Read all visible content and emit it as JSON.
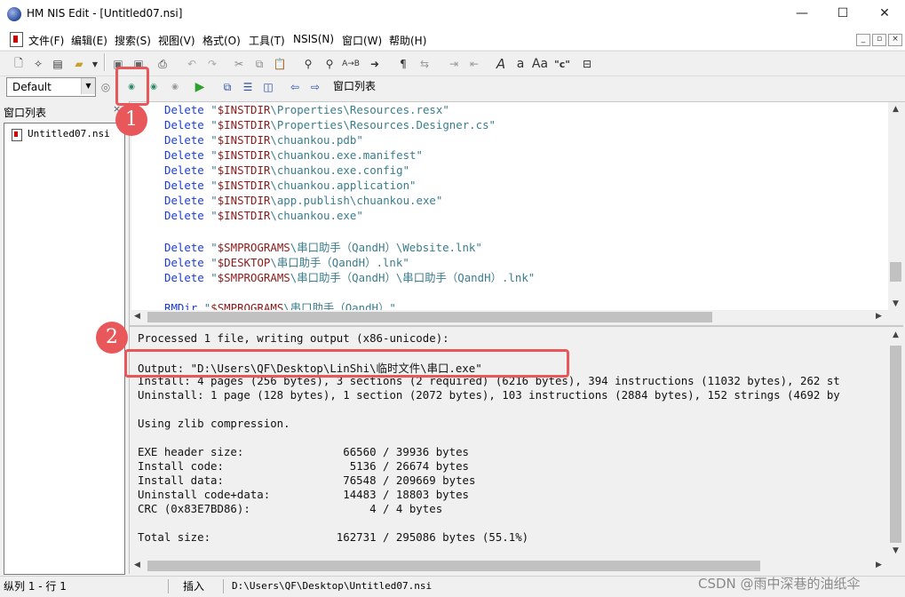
{
  "window": {
    "title": "HM NIS Edit - [Untitled07.nsi]",
    "min": "—",
    "max": "☐",
    "close": "✕"
  },
  "menu": [
    "文件(F)",
    "编辑(E)",
    "搜索(S)",
    "视图(V)",
    "格式(O)",
    "工具(T)",
    "NSIS(N)",
    "窗口(W)",
    "帮助(H)"
  ],
  "toolbar": {
    "preset": "Default",
    "window_list": "窗口列表"
  },
  "left_panel": {
    "title": "窗口列表",
    "close": "×",
    "file": "Untitled07.nsi"
  },
  "editor": {
    "lines": [
      {
        "kw": "Delete",
        "var": "$INSTDIR",
        "rest": "\\Properties\\Resources.resx\""
      },
      {
        "kw": "Delete",
        "var": "$INSTDIR",
        "rest": "\\Properties\\Resources.Designer.cs\""
      },
      {
        "kw": "Delete",
        "var": "$INSTDIR",
        "rest": "\\chuankou.pdb\""
      },
      {
        "kw": "Delete",
        "var": "$INSTDIR",
        "rest": "\\chuankou.exe.manifest\""
      },
      {
        "kw": "Delete",
        "var": "$INSTDIR",
        "rest": "\\chuankou.exe.config\""
      },
      {
        "kw": "Delete",
        "var": "$INSTDIR",
        "rest": "\\chuankou.application\""
      },
      {
        "kw": "Delete",
        "var": "$INSTDIR",
        "rest": "\\app.publish\\chuankou.exe\""
      },
      {
        "kw": "Delete",
        "var": "$INSTDIR",
        "rest": "\\chuankou.exe\""
      },
      {
        "kw": "Delete",
        "var": "$SMPROGRAMS",
        "rest": "\\串口助手（QandH）\\Website.lnk\""
      },
      {
        "kw": "Delete",
        "var": "$DESKTOP",
        "rest": "\\串口助手（QandH）.lnk\""
      },
      {
        "kw": "Delete",
        "var": "$SMPROGRAMS",
        "rest": "\\串口助手（QandH）\\串口助手（QandH）.lnk\""
      },
      {
        "kw": "RMDir",
        "var": "$SMPROGRAMS",
        "rest": "\\串口助手（QandH）\""
      }
    ]
  },
  "output": {
    "lines": [
      "Processed 1 file, writing output (x86-unicode):",
      "",
      "Output: \"D:\\Users\\QF\\Desktop\\LinShi\\临时文件\\串口.exe\"",
      "Install: 4 pages (256 bytes), 3 sections (2 required) (6216 bytes), 394 instructions (11032 bytes), 262 st",
      "Uninstall: 1 page (128 bytes), 1 section (2072 bytes), 103 instructions (2884 bytes), 152 strings (4692 by",
      "",
      "Using zlib compression.",
      "",
      "EXE header size:               66560 / 39936 bytes",
      "Install code:                   5136 / 26674 bytes",
      "Install data:                  76548 / 209669 bytes",
      "Uninstall code+data:           14483 / 18803 bytes",
      "CRC (0x83E7BD86):                  4 / 4 bytes",
      "",
      "Total size:                   162731 / 295086 bytes (55.1%)"
    ]
  },
  "status": {
    "position": "纵列 1 - 行 1",
    "mode": "插入",
    "path": "D:\\Users\\QF\\Desktop\\Untitled07.nsi"
  },
  "annotations": {
    "badge1": "1",
    "badge2": "2"
  },
  "watermark": "CSDN @雨中深巷的油纸伞",
  "colors": {
    "annotation_red": "#e8585b",
    "keyword_blue": "#1a3dd6",
    "variable_red": "#8b1a1a",
    "string_teal": "#3a7d8c"
  }
}
